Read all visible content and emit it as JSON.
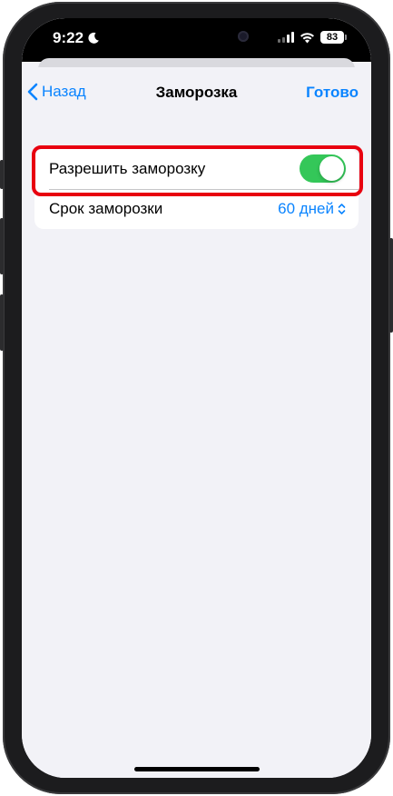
{
  "status_bar": {
    "time": "9:22",
    "focus_icon": "moon-icon",
    "battery": "83",
    "signal_icon": "cellular-signal-icon",
    "wifi_icon": "wifi-icon"
  },
  "nav": {
    "back_label": "Назад",
    "title": "Заморозка",
    "done_label": "Готово"
  },
  "settings": {
    "allow_freeze": {
      "label": "Разрешить заморозку",
      "enabled": true
    },
    "freeze_period": {
      "label": "Срок заморозки",
      "value": "60 дней"
    }
  },
  "colors": {
    "accent": "#0a84ff",
    "toggle_on": "#34c759",
    "highlight": "#e8000f"
  }
}
